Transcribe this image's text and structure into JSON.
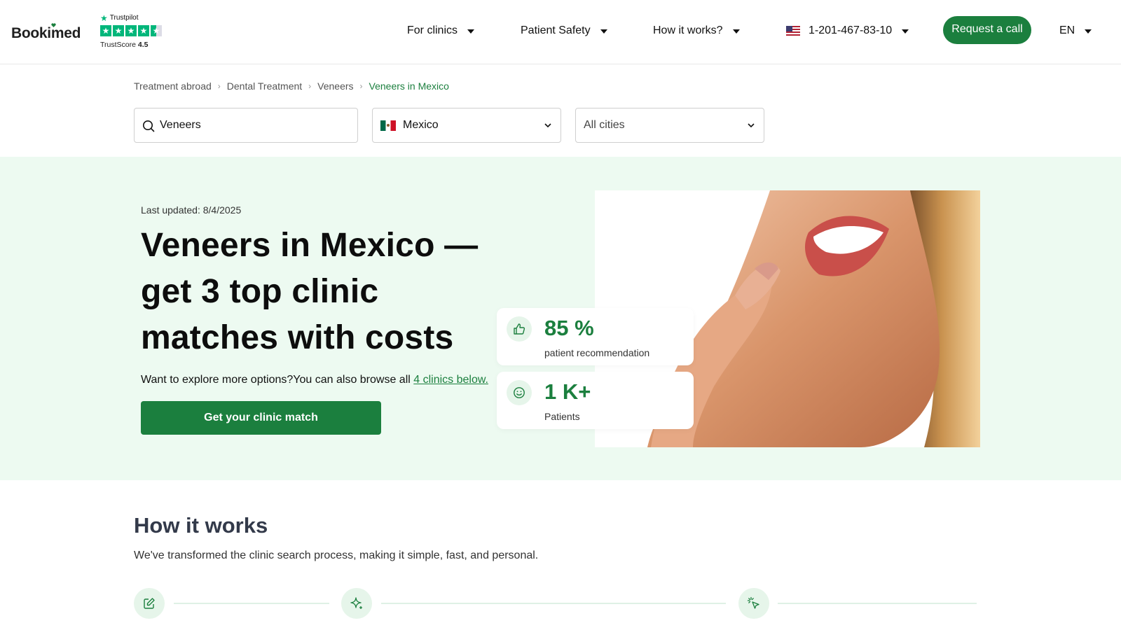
{
  "header": {
    "logo": "Bookimed",
    "trustpilot": {
      "name": "Trustpilot",
      "score_label": "TrustScore",
      "score": "4.5"
    },
    "nav": [
      {
        "label": "For clinics"
      },
      {
        "label": "Patient Safety"
      },
      {
        "label": "How it works?"
      }
    ],
    "phone": "1-201-467-83-10",
    "request_call": "Request a call",
    "language": "EN"
  },
  "breadcrumb": [
    "Treatment abroad",
    "Dental Treatment",
    "Veneers",
    "Veneers in Mexico"
  ],
  "search": {
    "query": "Veneers",
    "country": "Mexico",
    "city": "All cities"
  },
  "hero": {
    "last_updated": "Last updated: 8/4/2025",
    "title": "Veneers in Mexico — get 3 top clinic matches with costs",
    "subtitle_prefix": "Want to explore more options?You can also browse all ",
    "subtitle_link": "4 clinics below.",
    "cta": "Get your clinic match",
    "stats": [
      {
        "value": "85 %",
        "label": "patient recommendation",
        "icon": "thumbs-up-icon"
      },
      {
        "value": "1 K+",
        "label": "Patients",
        "icon": "smile-icon"
      }
    ]
  },
  "how_it_works": {
    "title": "How it works",
    "subtitle": "We've transformed the clinic search process, making it simple, fast, and personal.",
    "step_icons": [
      "edit-icon",
      "sparkle-icon",
      "cursor-click-icon"
    ]
  },
  "colors": {
    "brand_green": "#1b7f3e",
    "hero_bg": "#edfaf1",
    "trustpilot_green": "#00b67a"
  }
}
